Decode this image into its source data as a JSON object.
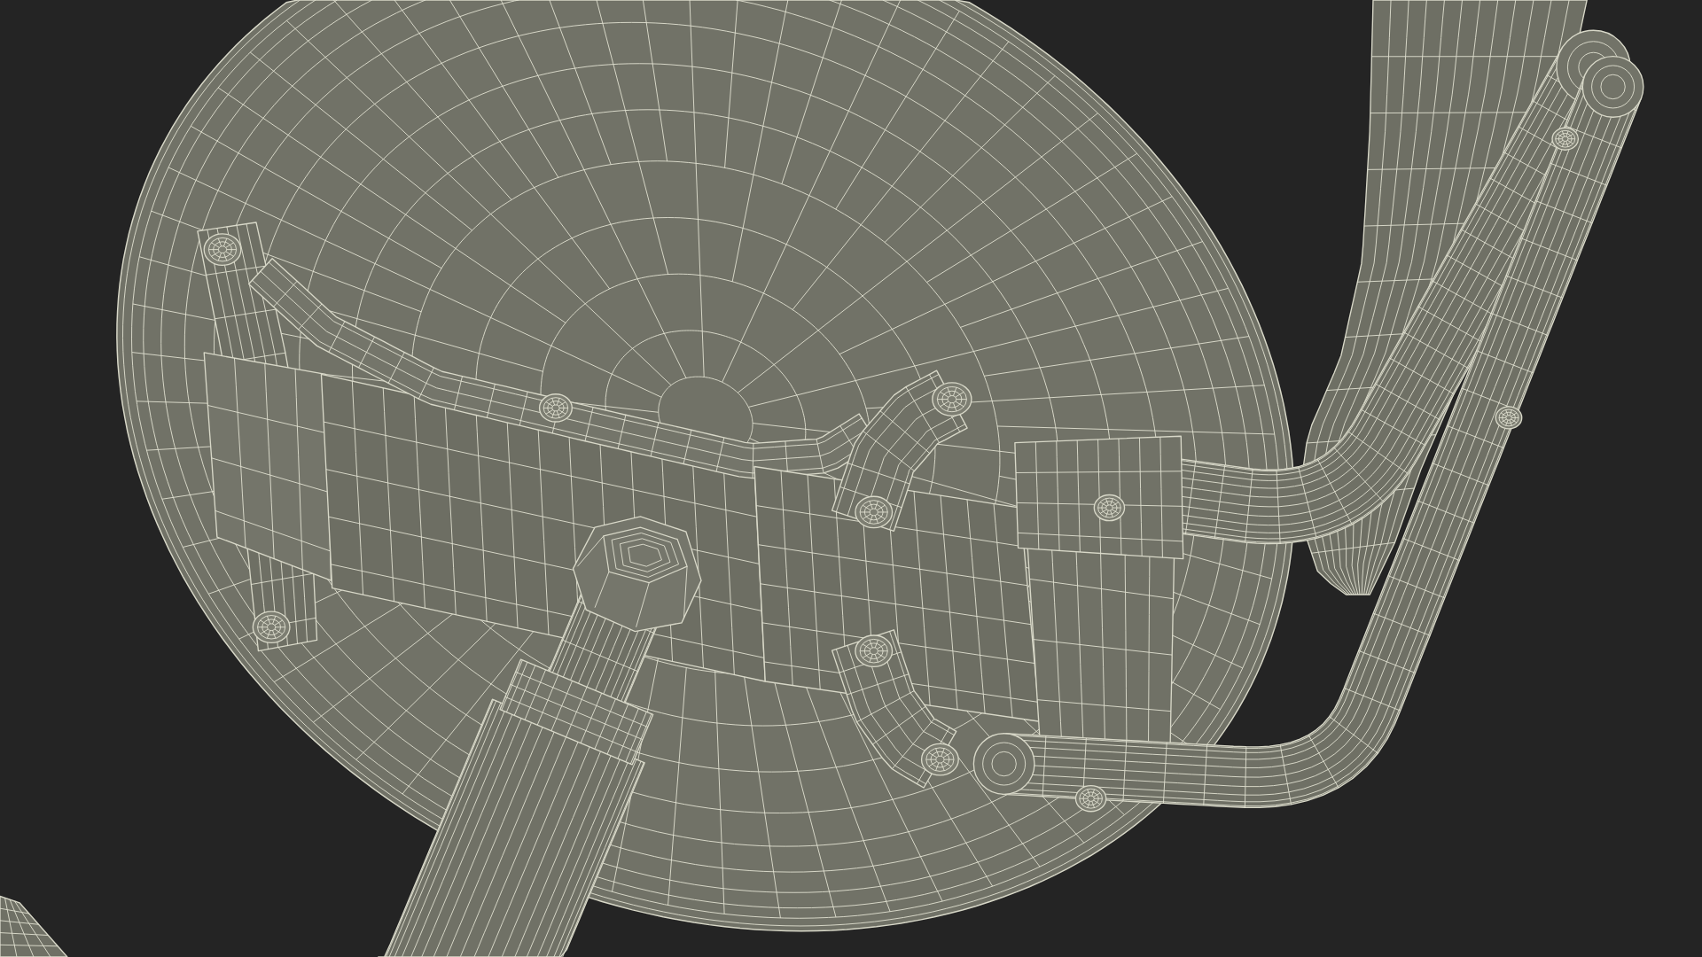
{
  "viewport": {
    "wireframe": true
  }
}
